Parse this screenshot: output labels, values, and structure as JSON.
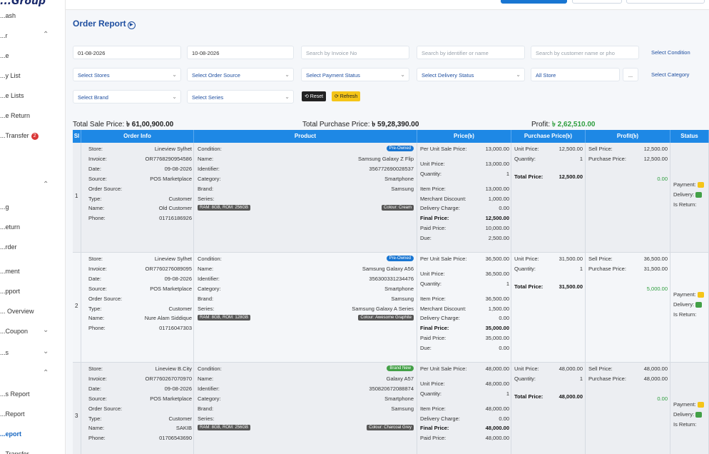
{
  "brand": "...Group",
  "sidebar": {
    "items": [
      {
        "label": "...ash",
        "chev": ""
      },
      {
        "label": "...r",
        "chev": "⌃"
      },
      {
        "label": "...e",
        "chev": ""
      },
      {
        "label": "...y List",
        "chev": ""
      },
      {
        "label": "...e Lists",
        "chev": ""
      },
      {
        "label": "...e Return",
        "chev": ""
      },
      {
        "label": "...Transfer",
        "chev": "",
        "badge": "2"
      },
      {
        "label": "",
        "chev": ""
      },
      {
        "label": "",
        "chev": "⌃"
      },
      {
        "label": "...g",
        "chev": ""
      },
      {
        "label": "...eturn",
        "chev": ""
      },
      {
        "label": "...rder",
        "chev": ""
      },
      {
        "label": "...ment",
        "chev": ""
      },
      {
        "label": "...pport",
        "chev": ""
      },
      {
        "label": "... Overview",
        "chev": ""
      },
      {
        "label": "...Coupon",
        "chev": "⌄"
      },
      {
        "label": "...s",
        "chev": "⌄"
      },
      {
        "label": "",
        "chev": "⌃"
      },
      {
        "label": "...s Report",
        "chev": ""
      },
      {
        "label": "...Report",
        "chev": ""
      },
      {
        "label": "...eport",
        "chev": "",
        "active": true
      },
      {
        "label": "...Transfer...",
        "chev": ""
      }
    ]
  },
  "page_title": "Order Report",
  "filters": {
    "date_from": "01-08-2026",
    "date_to": "10-08-2026",
    "search_invoice": "Search by Invoice No",
    "search_identifier": "Search by identifier or name",
    "search_customer": "Search by customer name or pho",
    "select_condition": "Select Condition",
    "select_stores": "Select Stores",
    "select_order_source": "Select Order Source",
    "select_payment_status": "Select Payment Status",
    "select_delivery_status": "Select Delivery Status",
    "all_store": "All Store",
    "ellipsis": "...",
    "select_category": "Select Category",
    "select_brand": "Select Brand",
    "select_series": "Select Series",
    "reset_label": "⟲ Reset",
    "refresh_label": "⟳ Refresh"
  },
  "totals": {
    "sale_label": "Total Sale Price:",
    "sale_value": "৳ 61,00,900.00",
    "purchase_label": "Total Purchase Price:",
    "purchase_value": "৳ 59,28,390.00",
    "profit_label": "Profit:",
    "profit_value": "৳ 2,62,510.00"
  },
  "table": {
    "headers": [
      "Sl",
      "Order Info",
      "Product",
      "Price(৳)",
      "Purchase Price(৳)",
      "Profit(৳)",
      "Status"
    ],
    "rows": [
      {
        "sl": "1",
        "info": {
          "store": "Lineview Sylhet",
          "invoice": "OR7768290954586",
          "date": "09-08-2026",
          "source": "POS Marketplace",
          "order_source": "",
          "type": "Customer",
          "name": "Old Customer",
          "phone": "01716186926"
        },
        "product": {
          "badge": "Pre-Owned",
          "badge_color": "blue",
          "name": "Samsung Galaxy Z Flip",
          "identifier": "356772690028537",
          "category": "Smartphone",
          "brand": "Samsung",
          "series": "",
          "tag_left": "RAM: 8GB, ROM: 256GB",
          "tag_right": "Colour: Cream"
        },
        "price": {
          "per_unit": "13,000.00",
          "unit_price": "13,000.00",
          "quantity": "1",
          "item_price": "13,000.00",
          "merchant_discount": "1,000.00",
          "delivery_charge": "0.00",
          "final_price": "12,500.00",
          "paid_price": "10,000.00",
          "due": "2,500.00"
        },
        "purchase": {
          "unit_price": "12,500.00",
          "quantity": "1",
          "total": "12,500.00"
        },
        "profit": {
          "sell_price": "12,500.00",
          "purchase_price": "12,500.00",
          "profit": "0.00"
        },
        "status": {
          "payment": "Payment:",
          "delivery": "Delivery:",
          "return": "Is Return:"
        }
      },
      {
        "sl": "2",
        "info": {
          "store": "Lineview Sylhet",
          "invoice": "OR7760276089095",
          "date": "09-08-2026",
          "source": "POS Marketplace",
          "order_source": "",
          "type": "Customer",
          "name": "Nure Alam Siddique",
          "phone": "01716047303"
        },
        "product": {
          "badge": "Pre-Owned",
          "badge_color": "blue",
          "name": "Samsung Galaxy A56",
          "identifier": "356300331234476",
          "category": "Smartphone",
          "brand": "Samsung",
          "series": "Samsung Galaxy A Series",
          "tag_left": "RAM: 8GB, ROM: 128GB",
          "tag_right": "Colour: Awesome Graphite"
        },
        "price": {
          "per_unit": "36,500.00",
          "unit_price": "36,500.00",
          "quantity": "1",
          "item_price": "36,500.00",
          "merchant_discount": "1,500.00",
          "delivery_charge": "0.00",
          "final_price": "35,000.00",
          "paid_price": "35,000.00",
          "due": "0.00"
        },
        "purchase": {
          "unit_price": "31,500.00",
          "quantity": "1",
          "total": "31,500.00"
        },
        "profit": {
          "sell_price": "36,500.00",
          "purchase_price": "31,500.00",
          "profit": "5,000.00"
        },
        "status": {
          "payment": "Payment:",
          "delivery": "Delivery:",
          "return": "Is Return:"
        }
      },
      {
        "sl": "3",
        "info": {
          "store": "Lineview B.City",
          "invoice": "OR7760267070970",
          "date": "09-08-2026",
          "source": "POS Marketplace",
          "order_source": "",
          "type": "Customer",
          "name": "SAKIB",
          "phone": "01706543690"
        },
        "product": {
          "badge": "Brand New",
          "badge_color": "green",
          "name": "Galaxy A57",
          "identifier": "350820672088874",
          "category": "Smartphone",
          "brand": "Samsung",
          "series": "",
          "tag_left": "RAM: 8GB, ROM: 256GB",
          "tag_right": "Colour: Charcoal Grey"
        },
        "price": {
          "per_unit": "48,000.00",
          "unit_price": "48,000.00",
          "quantity": "1",
          "item_price": "48,000.00",
          "merchant_discount": "",
          "delivery_charge": "0.00",
          "final_price": "48,000.00",
          "paid_price": "48,000.00",
          "due": ""
        },
        "purchase": {
          "unit_price": "48,000.00",
          "quantity": "1",
          "total": "48,000.00"
        },
        "profit": {
          "sell_price": "48,000.00",
          "purchase_price": "48,000.00",
          "profit": "0.00"
        },
        "status": {
          "payment": "Payment:",
          "delivery": "Delivery:",
          "return": "Is Return:"
        }
      }
    ]
  },
  "labels": {
    "store": "Store:",
    "invoice": "Invoice:",
    "date": "Date:",
    "source": "Source:",
    "order_source": "Order Source:",
    "type": "Type:",
    "name": "Name:",
    "phone": "Phone:",
    "condition": "Condition:",
    "p_name": "Name:",
    "identifier": "Identifier:",
    "category": "Category:",
    "brand": "Brand:",
    "series": "Series:",
    "per_unit": "Per Unit Sale Price:",
    "unit_price": "Unit Price:",
    "quantity": "Quantity:",
    "item_price": "Item Price:",
    "merchant_discount": "Merchant Discount:",
    "delivery_charge": "Delivery Charge:",
    "final_price": "Final Price:",
    "paid_price": "Paid Price:",
    "due": "Due:",
    "pu_unit_price": "Unit Price:",
    "pu_quantity": "Quantity:",
    "pu_total": "Total Price:",
    "sell_price": "Sell Price:",
    "purchase_price": "Purchase Price:"
  },
  "colors": {
    "primary": "#1e88e5",
    "title": "#1f4fa0",
    "profit_green": "#2e9e3e",
    "badge_red": "#d93636"
  }
}
